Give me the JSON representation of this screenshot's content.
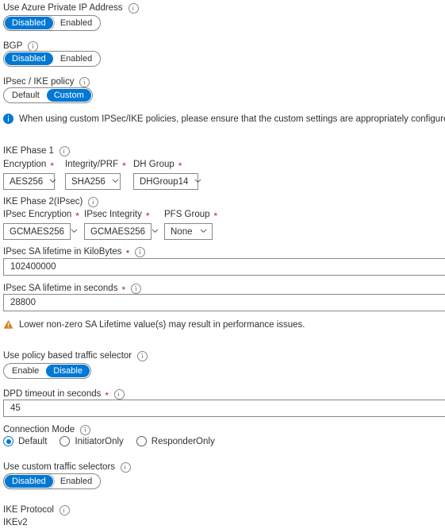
{
  "form": {
    "private_ip": {
      "label": "Use Azure Private IP Address",
      "info_icon": "info-circle-icon",
      "options": [
        "Disabled",
        "Enabled"
      ],
      "selected": "Disabled",
      "focused": true
    },
    "bgp": {
      "label": "BGP",
      "info_icon": "info-circle-icon",
      "options": [
        "Disabled",
        "Enabled"
      ],
      "selected": "Disabled",
      "focused": false
    },
    "ipsec_ike_policy": {
      "label": "IPsec / IKE policy",
      "info_icon": "info-circle-icon",
      "options": [
        "Default",
        "Custom"
      ],
      "selected": "Custom",
      "focused": false
    },
    "info_message": {
      "icon": "info-filled-icon",
      "text": "When using custom IPSec/IKE policies, please ensure that the custom settings are appropriately configured on the on-premise device for"
    },
    "ike_phase1": {
      "section_label": "IKE Phase 1",
      "info_icon": "info-circle-icon",
      "fields": [
        {
          "label": "Encryption",
          "required": "*",
          "value": "AES256"
        },
        {
          "label": "Integrity/PRF",
          "required": "*",
          "value": "SHA256"
        },
        {
          "label": "DH Group",
          "required": "*",
          "value": "DHGroup14"
        }
      ]
    },
    "ike_phase2": {
      "section_label": "IKE Phase 2(IPsec)",
      "info_icon": "info-circle-icon",
      "fields": [
        {
          "label": "IPsec Encryption",
          "required": "*",
          "value": "GCMAES256"
        },
        {
          "label": "IPsec Integrity",
          "required": "*",
          "value": "GCMAES256"
        },
        {
          "label": "PFS Group",
          "required": "*",
          "value": "None"
        }
      ]
    },
    "sa_kilobytes": {
      "label": "IPsec SA lifetime in KiloBytes",
      "required": "*",
      "info_icon": "info-circle-icon",
      "value": "102400000"
    },
    "sa_seconds": {
      "label": "IPsec SA lifetime in seconds",
      "required": "*",
      "info_icon": "info-circle-icon",
      "value": "28800"
    },
    "warning_message": {
      "icon": "warning-triangle-icon",
      "text": "Lower non-zero SA Lifetime value(s) may result in performance issues."
    },
    "policy_based_traffic_selector": {
      "label": "Use policy based traffic selector",
      "info_icon": "info-circle-icon",
      "options": [
        "Enable",
        "Disable"
      ],
      "selected": "Disable",
      "focused": false
    },
    "dpd_timeout": {
      "label": "DPD timeout in seconds",
      "required": "*",
      "info_icon": "info-circle-icon",
      "value": "45"
    },
    "connection_mode": {
      "label": "Connection Mode",
      "info_icon": "info-circle-icon",
      "options": [
        "Default",
        "InitiatorOnly",
        "ResponderOnly"
      ],
      "selected": "Default"
    },
    "custom_traffic_selectors": {
      "label": "Use custom traffic selectors",
      "info_icon": "info-circle-icon",
      "options": [
        "Disabled",
        "Enabled"
      ],
      "selected": "Disabled",
      "focused": true
    },
    "ike_protocol": {
      "label": "IKE Protocol",
      "info_icon": "info-circle-icon",
      "value": "IKEv2"
    }
  }
}
